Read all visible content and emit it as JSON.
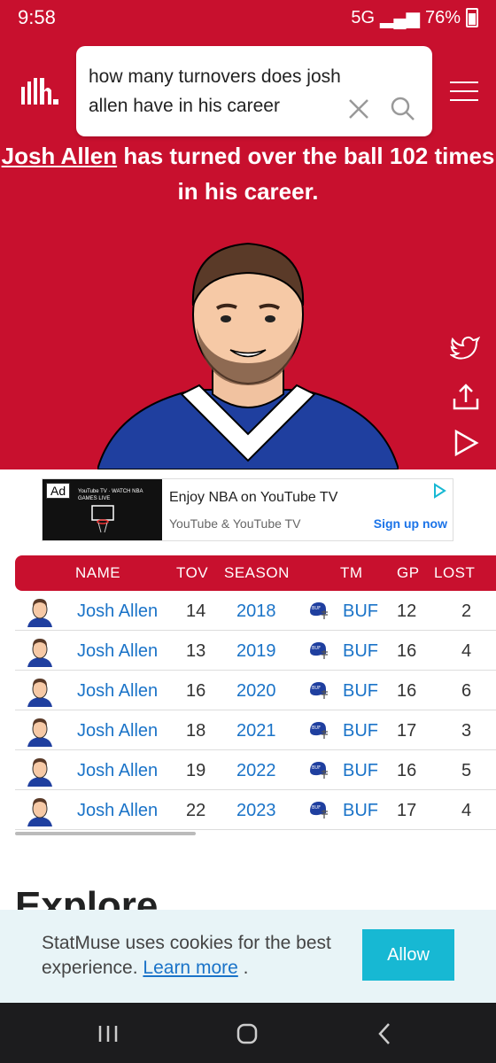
{
  "status": {
    "time": "9:58",
    "network": "5G",
    "battery": "76%"
  },
  "search": {
    "query": "how many turnovers does josh allen have in his career"
  },
  "answer": {
    "player": "Josh Allen",
    "text": " has turned over the ball 102 times in his career."
  },
  "ad": {
    "badge": "Ad",
    "image_caption": "YouTube TV · WATCH NBA GAMES LIVE",
    "title": "Enjoy NBA on YouTube TV",
    "advertiser": "YouTube & YouTube TV",
    "cta": "Sign up now"
  },
  "table": {
    "headers": [
      "NAME",
      "TOV",
      "SEASON",
      "TM",
      "GP",
      "LOST"
    ],
    "rows": [
      {
        "name": "Josh Allen",
        "tov": "14",
        "season": "2018",
        "team_logo": "BUF",
        "tm": "BUF",
        "gp": "12",
        "lost": "2"
      },
      {
        "name": "Josh Allen",
        "tov": "13",
        "season": "2019",
        "team_logo": "BUF",
        "tm": "BUF",
        "gp": "16",
        "lost": "4"
      },
      {
        "name": "Josh Allen",
        "tov": "16",
        "season": "2020",
        "team_logo": "BUF",
        "tm": "BUF",
        "gp": "16",
        "lost": "6"
      },
      {
        "name": "Josh Allen",
        "tov": "18",
        "season": "2021",
        "team_logo": "BUF",
        "tm": "BUF",
        "gp": "17",
        "lost": "3"
      },
      {
        "name": "Josh Allen",
        "tov": "19",
        "season": "2022",
        "team_logo": "BUF",
        "tm": "BUF",
        "gp": "16",
        "lost": "5"
      },
      {
        "name": "Josh Allen",
        "tov": "22",
        "season": "2023",
        "team_logo": "BUF",
        "tm": "BUF",
        "gp": "17",
        "lost": "4"
      }
    ]
  },
  "explore": {
    "title": "Explore"
  },
  "cookie": {
    "text": "StatMuse uses cookies for the best experience. ",
    "link": "Learn more",
    "suffix": " .",
    "button": "Allow"
  },
  "colors": {
    "brand": "#c8102e",
    "link": "#1a73c8",
    "cookie_button": "#17b8d3"
  }
}
